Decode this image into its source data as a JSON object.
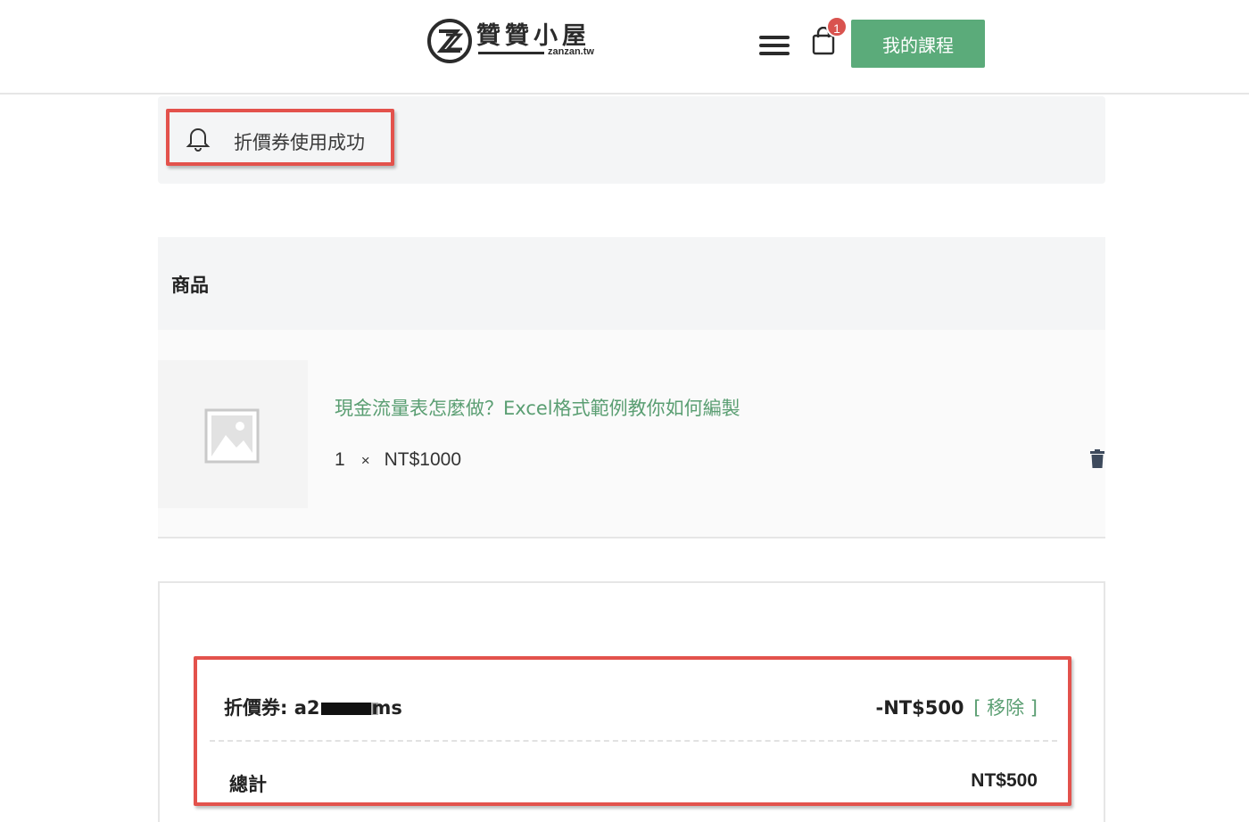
{
  "header": {
    "logo_title": "贊贊小屋",
    "logo_subtitle": "zanzan.tw",
    "cart_count": "1",
    "my_courses_label": "我的課程",
    "accent_color": "#5bab7a",
    "icons": [
      "logo-icon",
      "menu-icon",
      "shopping-bag-icon"
    ]
  },
  "notice": {
    "message": "折價券使用成功",
    "icon": "bell-icon"
  },
  "products": {
    "header_label": "商品",
    "items": [
      {
        "title": "現金流量表怎麼做？Excel格式範例教你如何編製",
        "quantity": "1",
        "multiply": "×",
        "price": "NT$1000",
        "thumbnail_icon": "image-placeholder-icon",
        "delete_icon": "trash-icon"
      }
    ]
  },
  "totals": {
    "coupon_prefix": "折價券: a2",
    "coupon_suffix": "ms",
    "coupon_discount": "-NT$500",
    "remove_label": "[ 移除 ]",
    "total_label": "總計",
    "total_value": "NT$500"
  },
  "highlight_color": "#e3524c"
}
